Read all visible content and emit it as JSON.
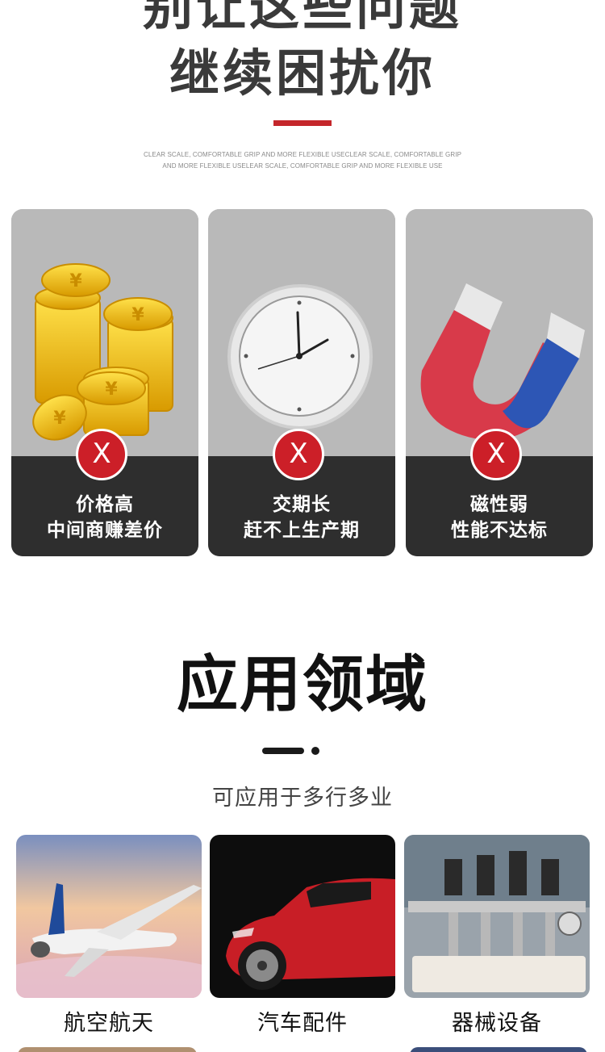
{
  "header": {
    "headline_line1": "别让这些问题",
    "headline_line2": "继续困扰你",
    "tagline": "CLEAR SCALE, COMFORTABLE GRIP AND MORE FLEXIBLE USECLEAR SCALE, COMFORTABLE GRIP AND MORE FLEXIBLE USELEAR SCALE, COMFORTABLE GRIP AND MORE FLEXIBLE USE"
  },
  "problems": [
    {
      "icon": "coins-icon",
      "mark": "X",
      "line1": "价格高",
      "line2": "中间商赚差价"
    },
    {
      "icon": "clock-icon",
      "mark": "X",
      "line1": "交期长",
      "line2": "赶不上生产期"
    },
    {
      "icon": "magnet-icon",
      "mark": "X",
      "line1": "磁性弱",
      "line2": "性能不达标"
    }
  ],
  "applications": {
    "title": "应用领域",
    "subtitle": "可应用于多行多业",
    "items": [
      {
        "label": "航空航天",
        "image": "airplane-image"
      },
      {
        "label": "汽车配件",
        "image": "car-image"
      },
      {
        "label": "器械设备",
        "image": "machinery-image"
      }
    ]
  },
  "colors": {
    "accent_red": "#c4262b",
    "card_dark": "#2e2e2e",
    "card_gray": "#b9b9b9"
  }
}
